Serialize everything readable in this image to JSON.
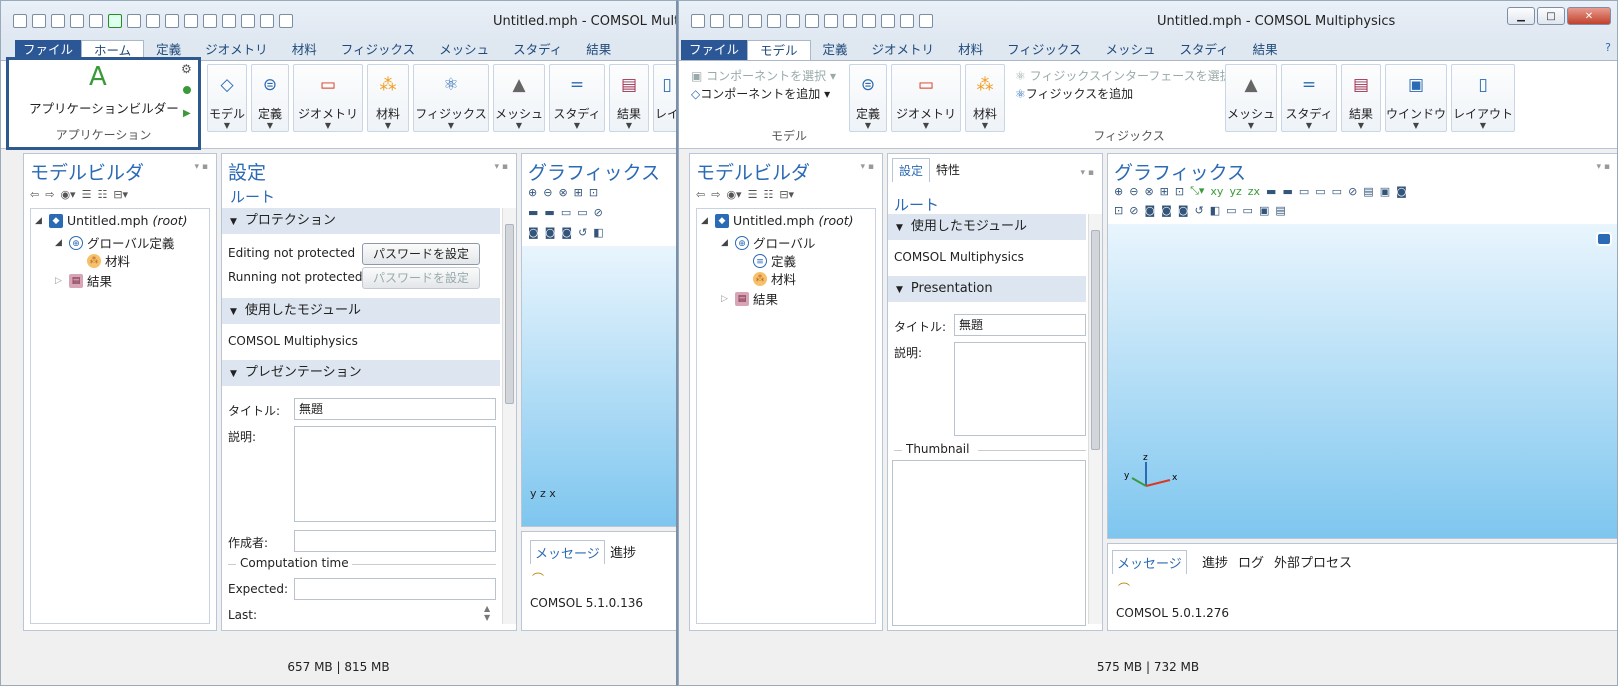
{
  "left": {
    "title": "Untitled.mph - COMSOL Multiph",
    "tabs": [
      "ファイル",
      "ホーム",
      "定義",
      "ジオメトリ",
      "材料",
      "フィジックス",
      "メッシュ",
      "スタディ",
      "結果"
    ],
    "app_builder": "アプリケーションビルダー",
    "app_group": "アプリケーション",
    "ribbon": [
      "モデル",
      "定義",
      "ジオメトリ",
      "材料",
      "フィジックス",
      "メッシュ",
      "スタディ",
      "結果",
      "レイ"
    ],
    "model_builder": "モデルビルダ",
    "tree": {
      "root": "Untitled.mph",
      "root_suffix": "(root)",
      "global": "グローバル定義",
      "material": "材料",
      "results": "結果"
    },
    "settings": {
      "title": "設定",
      "subtitle": "ルート",
      "sec_protection": "プロテクション",
      "editing": "Editing not protected",
      "running": "Running not protected",
      "set_password": "パスワードを設定",
      "sec_modules": "使用したモジュール",
      "module": "COMSOL Multiphysics",
      "sec_presentation": "プレゼンテーション",
      "title_label": "タイトル:",
      "title_value": "無題",
      "desc_label": "説明:",
      "author_label": "作成者:",
      "comp_time": "Computation time",
      "expected": "Expected:",
      "last": "Last:"
    },
    "graphics": {
      "title": "グラフィックス",
      "axes": "y z x"
    },
    "messages": {
      "tab1": "メッセージ",
      "tab2": "進捗",
      "text": "COMSOL 5.1.0.136"
    },
    "status": "657 MB | 815 MB"
  },
  "right": {
    "title": "Untitled.mph - COMSOL Multiphysics",
    "tabs": [
      "ファイル",
      "モデル",
      "定義",
      "ジオメトリ",
      "材料",
      "フィジックス",
      "メッシュ",
      "スタディ",
      "結果"
    ],
    "select_component": "コンポーネントを選択",
    "add_component": "コンポーネントを追加",
    "model_group": "モデル",
    "ribbon": [
      "定義",
      "ジオメトリ",
      "材料",
      "メッシュ",
      "スタディ",
      "結果",
      "ウインドウ",
      "レイアウト"
    ],
    "select_physics": "フィジックスインターフェースを選択",
    "add_physics": "フィジックスを追加",
    "physics_group": "フィジックス",
    "model_builder": "モデルビルダ",
    "tree": {
      "root": "Untitled.mph",
      "root_suffix": "(root)",
      "global": "グローバル",
      "definitions": "定義",
      "material": "材料",
      "results": "結果"
    },
    "settings": {
      "tab1": "設定",
      "tab2": "特性",
      "subtitle": "ルート",
      "sec_modules": "使用したモジュール",
      "module": "COMSOL Multiphysics",
      "sec_presentation": "Presentation",
      "title_label": "タイトル:",
      "title_value": "無題",
      "desc_label": "説明:",
      "thumbnail": "Thumbnail"
    },
    "graphics": {
      "title": "グラフィックス"
    },
    "messages": {
      "tab1": "メッセージ",
      "tab2": "進捗",
      "tab3": "ログ",
      "tab4": "外部プロセス",
      "text": "COMSOL 5.0.1.276"
    },
    "status": "575 MB | 732 MB"
  }
}
